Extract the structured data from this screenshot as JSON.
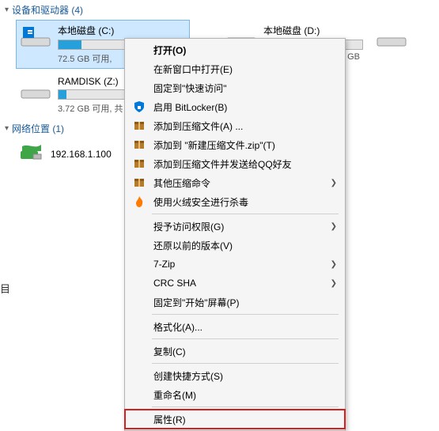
{
  "sections": {
    "devices": {
      "label": "设备和驱动器 (4)"
    },
    "network": {
      "label": "网络位置 (1)"
    }
  },
  "drives": {
    "c": {
      "name": "本地磁盘 (C:)",
      "space": "72.5 GB 可用,",
      "fill_pct": 18
    },
    "d": {
      "name": "本地磁盘 (D:)",
      "space_partial": "GB",
      "fill_pct": 20
    },
    "z": {
      "name": "RAMDISK (Z:)",
      "space": "3.72 GB 可用, 共",
      "fill_pct": 6
    }
  },
  "network_item": {
    "label": "192.168.1.100"
  },
  "truncated_label": "目",
  "ctx": {
    "open": "打开(O)",
    "open_new_window": "在新窗口中打开(E)",
    "pin_quick_access": "固定到\"快速访问\"",
    "bitlocker": "启用 BitLocker(B)",
    "add_archive": "添加到压缩文件(A) ...",
    "add_zip": "添加到 \"新建压缩文件.zip\"(T)",
    "add_send_qq": "添加到压缩文件并发送给QQ好友",
    "other_zip": "其他压缩命令",
    "huorong_av": "使用火绒安全进行杀毒",
    "grant_access": "授予访问权限(G)",
    "restore_prev": "还原以前的版本(V)",
    "sevenzip": "7-Zip",
    "crc_sha": "CRC SHA",
    "pin_start": "固定到\"开始\"屏幕(P)",
    "format": "格式化(A)...",
    "copy": "复制(C)",
    "create_shortcut": "创建快捷方式(S)",
    "rename": "重命名(M)",
    "properties": "属性(R)"
  }
}
